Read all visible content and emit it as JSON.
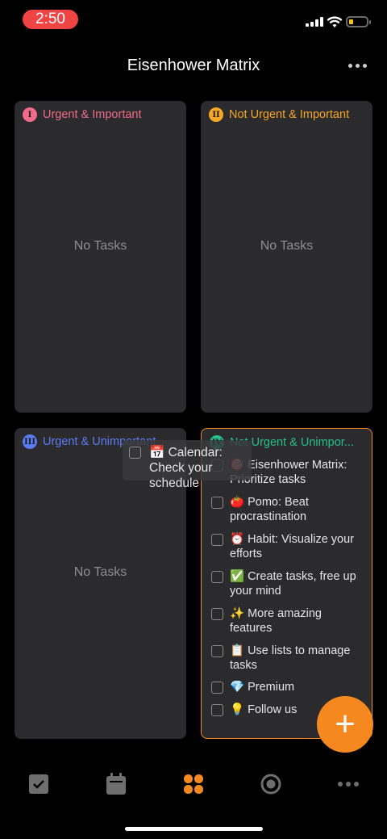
{
  "status": {
    "time": "2:50"
  },
  "header": {
    "title": "Eisenhower Matrix"
  },
  "quadrants": [
    {
      "badge": "I",
      "title": "Urgent & Important",
      "color": "#f06a8a",
      "empty_text": "No Tasks"
    },
    {
      "badge": "II",
      "title": "Not Urgent & Important",
      "color": "#f5a623",
      "empty_text": "No Tasks"
    },
    {
      "badge": "III",
      "title": "Urgent & Unimportant",
      "color": "#5b7cf5",
      "empty_text": "No Tasks"
    },
    {
      "badge": "IV",
      "title": "Not Urgent & Unimpor...",
      "color": "#27c08a"
    }
  ],
  "q4_tasks": [
    "🎯 Eisenhower Matrix: Prioritize tasks",
    "🍅 Pomo: Beat procrastination",
    "⏰ Habit: Visualize your efforts",
    "✅ Create tasks, free up your mind",
    "✨ More amazing features",
    "📋 Use lists to manage tasks",
    "💎 Premium",
    "💡 Follow us"
  ],
  "dragging_task": "📅 Calendar: Check your schedule",
  "fab": {
    "label": "+"
  },
  "tabbar": [
    "task-tab-icon",
    "calendar-tab-icon",
    "matrix-tab-icon",
    "focus-tab-icon",
    "more-tab-icon"
  ],
  "colors": {
    "accent": "#f5891f",
    "card": "#2b2a2d",
    "background": "#000000"
  }
}
